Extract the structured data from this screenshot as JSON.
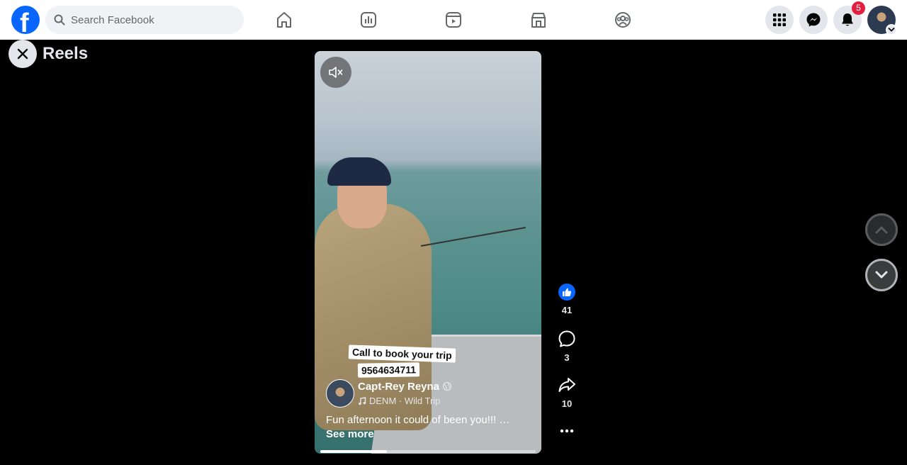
{
  "header": {
    "logo_letter": "f",
    "search": {
      "placeholder": "Search Facebook",
      "value": ""
    },
    "nav": [
      "home-icon",
      "stats-icon",
      "video-icon",
      "marketplace-icon",
      "groups-icon"
    ],
    "notifications_count": "5"
  },
  "reels": {
    "title": "Reels"
  },
  "video": {
    "stickers": [
      "Call to book your trip",
      "9564634711"
    ],
    "author": "Capt-Rey Reyna",
    "audio": "DENM · Wild Trip",
    "caption": "Fun afternoon it could of been you!!! …",
    "see_more": "See more",
    "progress": 0.31
  },
  "actions": {
    "likes": "41",
    "comments": "3",
    "shares": "10"
  },
  "colors": {
    "brand": "#0866ff",
    "badge": "#e41e3f"
  }
}
